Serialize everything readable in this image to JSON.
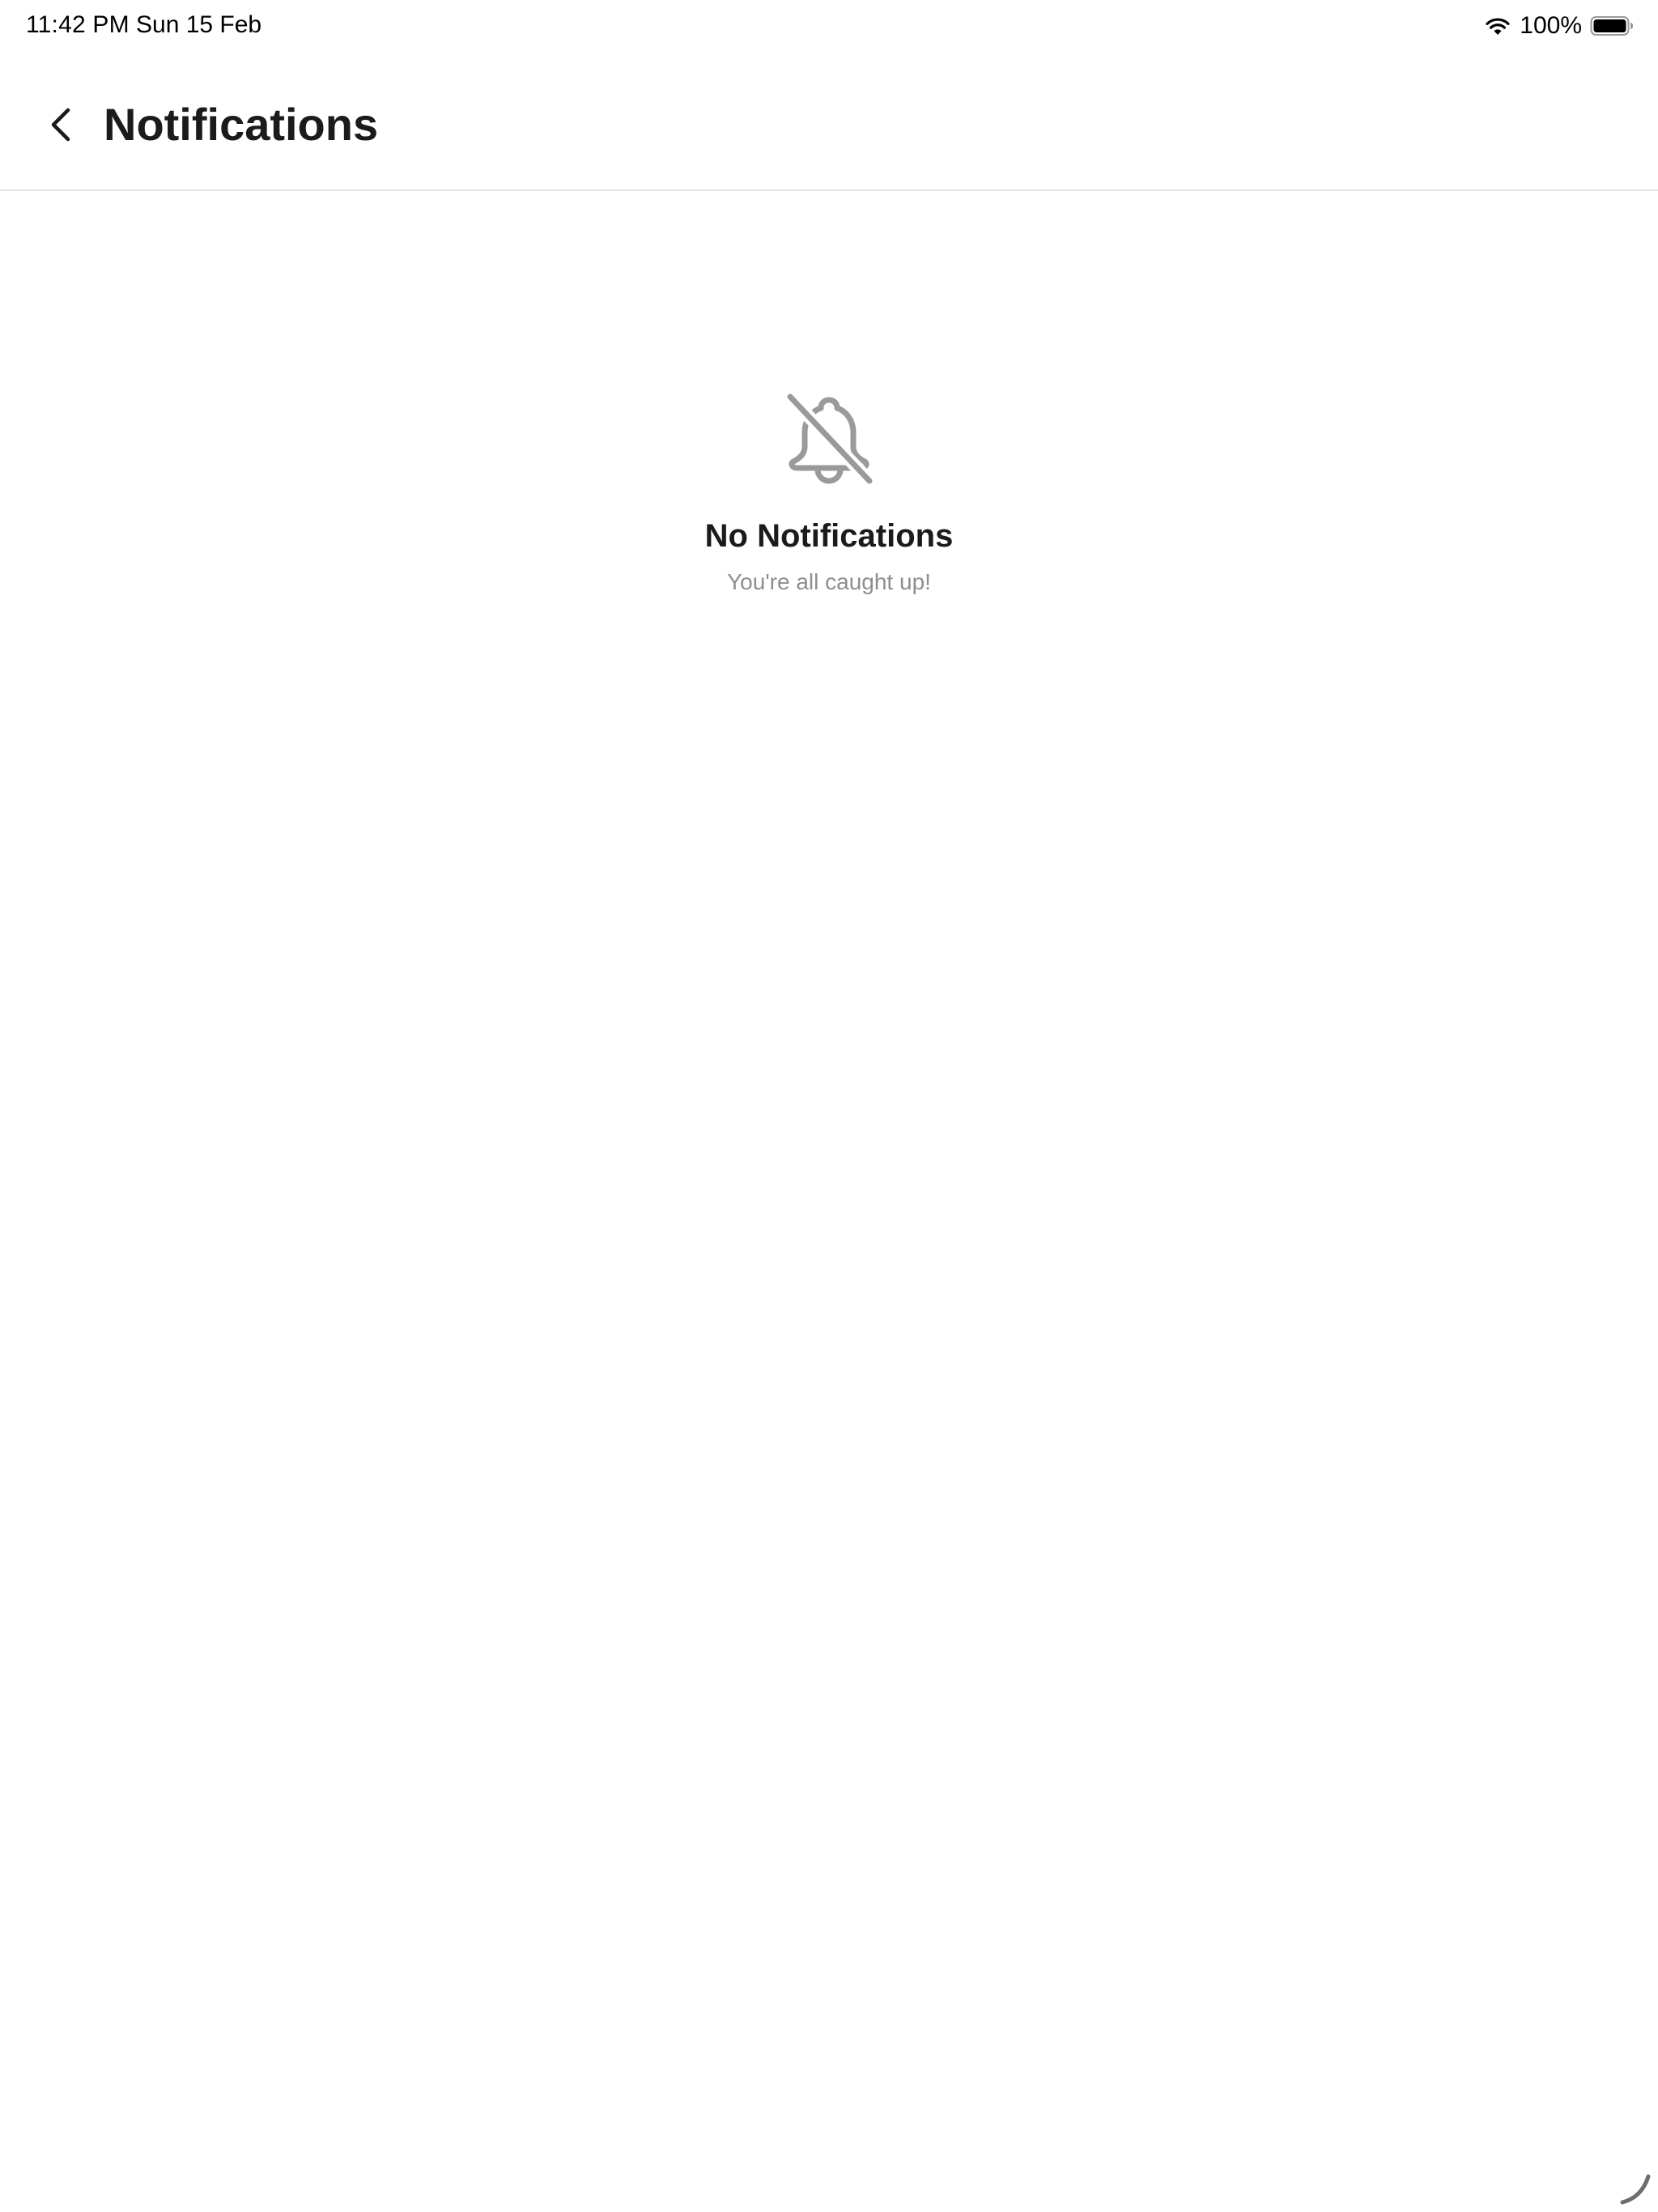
{
  "status_bar": {
    "time": "11:42 PM",
    "date": "Sun 15 Feb",
    "battery_percent": "100%",
    "wifi_icon": "wifi-icon",
    "battery_icon": "battery-full-icon"
  },
  "header": {
    "title": "Notifications",
    "back_icon": "chevron-left-icon"
  },
  "empty_state": {
    "icon": "bell-slash-icon",
    "title": "No Notifications",
    "subtitle": "You're all caught up!"
  },
  "colors": {
    "background": "#ffffff",
    "title_text": "#1b1b1b",
    "secondary_text": "#8e8e8e",
    "icon_gray": "#9a9a9a",
    "divider": "#e3e3e3"
  }
}
